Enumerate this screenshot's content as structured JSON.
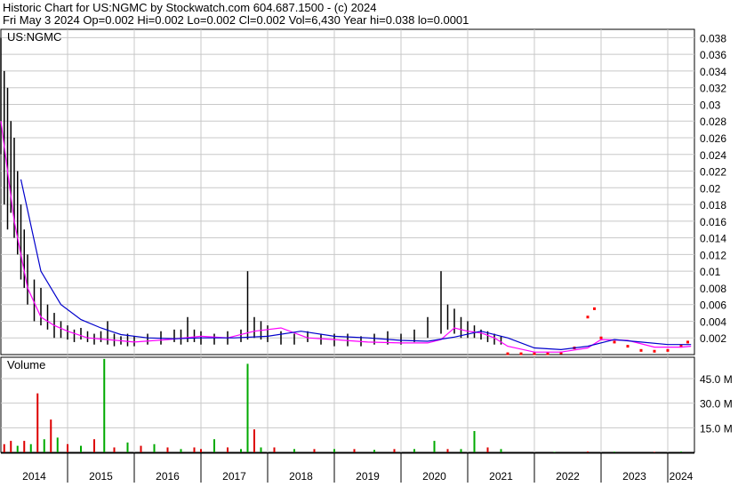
{
  "header": {
    "title_line": "Historic Chart for US:NGMC by Stockwatch.com 604.687.1500 - (c) 2024",
    "quote_line": "Fri May  3 2024  Op=0.002  Hi=0.002  Lo=0.002  Cl=0.002  Vol=6,430  Year hi=0.038  lo=0.0001"
  },
  "colors": {
    "background": "#ffffff",
    "grid": "#c8c8c8",
    "price_bar": "#000000",
    "price_low_marker": "#ff0000",
    "ma_short": "#ff00ff",
    "ma_long": "#0000cc",
    "volume_up": "#00aa00",
    "volume_down": "#dd0000"
  },
  "chart_data": [
    {
      "type": "line",
      "panel": "price",
      "title": "US:NGMC",
      "yticks": [
        "0.038",
        "0.036",
        "0.034",
        "0.032",
        "0.03",
        "0.028",
        "0.026",
        "0.024",
        "0.022",
        "0.02",
        "0.018",
        "0.016",
        "0.014",
        "0.012",
        "0.01",
        "0.008",
        "0.006",
        "0.004",
        "0.002"
      ],
      "ylim": [
        0.0,
        0.039
      ],
      "xlim": [
        2014.0,
        2024.4
      ],
      "grid": true,
      "series": [
        {
          "style": "bars",
          "x": [
            2014.0,
            2014.05,
            2014.1,
            2014.15,
            2014.2,
            2014.25,
            2014.3,
            2014.35,
            2014.4,
            2014.5,
            2014.6,
            2014.7,
            2014.8,
            2014.9,
            2015.0,
            2015.1,
            2015.2,
            2015.3,
            2015.4,
            2015.5,
            2015.6,
            2015.7,
            2015.8,
            2015.9,
            2016.0,
            2016.2,
            2016.4,
            2016.6,
            2016.7,
            2016.8,
            2016.9,
            2017.0,
            2017.2,
            2017.4,
            2017.6,
            2017.7,
            2017.8,
            2017.9,
            2018.0,
            2018.2,
            2018.4,
            2018.6,
            2018.8,
            2019.0,
            2019.2,
            2019.4,
            2019.6,
            2019.8,
            2020.0,
            2020.2,
            2020.4,
            2020.6,
            2020.7,
            2020.8,
            2020.9,
            2021.0,
            2021.1,
            2021.2,
            2021.3,
            2021.4,
            2021.5
          ],
          "low": [
            0.024,
            0.018,
            0.015,
            0.017,
            0.014,
            0.012,
            0.009,
            0.008,
            0.006,
            0.004,
            0.0035,
            0.003,
            0.002,
            0.002,
            0.0018,
            0.0015,
            0.0018,
            0.0015,
            0.0012,
            0.0015,
            0.0012,
            0.001,
            0.0012,
            0.001,
            0.001,
            0.0012,
            0.0012,
            0.0015,
            0.0012,
            0.0015,
            0.0015,
            0.0012,
            0.0012,
            0.0012,
            0.0015,
            0.0018,
            0.002,
            0.0018,
            0.0015,
            0.0012,
            0.0012,
            0.0015,
            0.0012,
            0.001,
            0.001,
            0.001,
            0.0012,
            0.0012,
            0.0012,
            0.0015,
            0.002,
            0.0025,
            0.003,
            0.0025,
            0.002,
            0.002,
            0.002,
            0.0018,
            0.0015,
            0.0012,
            0.0012
          ],
          "high": [
            0.038,
            0.034,
            0.032,
            0.028,
            0.026,
            0.022,
            0.018,
            0.015,
            0.012,
            0.009,
            0.008,
            0.006,
            0.005,
            0.004,
            0.0035,
            0.003,
            0.0032,
            0.0028,
            0.0025,
            0.0028,
            0.004,
            0.0025,
            0.0022,
            0.0025,
            0.0022,
            0.0025,
            0.0028,
            0.003,
            0.003,
            0.0045,
            0.003,
            0.0028,
            0.0025,
            0.0028,
            0.003,
            0.01,
            0.0045,
            0.004,
            0.0035,
            0.0028,
            0.0025,
            0.0028,
            0.0025,
            0.0025,
            0.0025,
            0.0022,
            0.0025,
            0.0028,
            0.0025,
            0.003,
            0.0045,
            0.01,
            0.006,
            0.0055,
            0.0045,
            0.004,
            0.0035,
            0.003,
            0.0028,
            0.0025,
            0.0022
          ]
        },
        {
          "name": "",
          "style": "lows",
          "x": [
            2021.6,
            2021.8,
            2022.0,
            2022.2,
            2022.4,
            2022.6,
            2022.8,
            2022.9,
            2023.0,
            2023.2,
            2023.4,
            2023.6,
            2023.8,
            2024.0,
            2024.2,
            2024.3
          ],
          "y": [
            0.0001,
            0.0001,
            0.0001,
            0.0001,
            0.0002,
            0.0008,
            0.0045,
            0.0055,
            0.002,
            0.0015,
            0.001,
            0.0005,
            0.0004,
            0.0005,
            0.001,
            0.0015
          ]
        },
        {
          "name": "",
          "style": "ma_short",
          "x": [
            2014.0,
            2014.2,
            2014.4,
            2014.6,
            2014.8,
            2015.0,
            2015.3,
            2015.6,
            2016.0,
            2016.5,
            2017.0,
            2017.4,
            2017.8,
            2018.2,
            2018.6,
            2019.0,
            2019.5,
            2020.0,
            2020.4,
            2020.6,
            2020.8,
            2021.0,
            2021.2,
            2021.4,
            2021.6,
            2022.0,
            2022.4,
            2022.8,
            2023.0,
            2023.4,
            2023.8,
            2024.2,
            2024.35
          ],
          "y": [
            0.028,
            0.016,
            0.008,
            0.0045,
            0.0035,
            0.0028,
            0.002,
            0.0018,
            0.0015,
            0.0018,
            0.0022,
            0.002,
            0.0028,
            0.0032,
            0.002,
            0.0018,
            0.0015,
            0.0014,
            0.0014,
            0.0018,
            0.0032,
            0.0028,
            0.0026,
            0.002,
            0.001,
            0.0003,
            0.0003,
            0.0008,
            0.0018,
            0.0017,
            0.0009,
            0.0009,
            0.001
          ]
        },
        {
          "name": "",
          "style": "ma_long",
          "x": [
            2014.3,
            2014.6,
            2014.9,
            2015.2,
            2015.5,
            2015.8,
            2016.2,
            2016.6,
            2017.0,
            2017.5,
            2018.0,
            2018.5,
            2019.0,
            2019.5,
            2020.0,
            2020.4,
            2020.8,
            2021.2,
            2021.6,
            2022.0,
            2022.4,
            2022.8,
            2023.2,
            2023.6,
            2024.0,
            2024.35
          ],
          "y": [
            0.021,
            0.01,
            0.006,
            0.0042,
            0.0032,
            0.0024,
            0.002,
            0.0019,
            0.002,
            0.002,
            0.0022,
            0.0028,
            0.0022,
            0.002,
            0.0017,
            0.0016,
            0.0021,
            0.0028,
            0.002,
            0.0008,
            0.0006,
            0.001,
            0.0018,
            0.0015,
            0.0012,
            0.0012
          ]
        }
      ]
    },
    {
      "type": "bar",
      "panel": "volume",
      "title": "Volume",
      "yticks": [
        "45.0 M",
        "30.0 M",
        "15.0 M"
      ],
      "ylim": [
        0,
        58
      ],
      "xlim": [
        2014.0,
        2024.4
      ],
      "x": [
        2014.05,
        2014.15,
        2014.25,
        2014.35,
        2014.45,
        2014.55,
        2014.65,
        2014.75,
        2014.85,
        2015.0,
        2015.2,
        2015.4,
        2015.55,
        2015.7,
        2015.9,
        2016.1,
        2016.3,
        2016.5,
        2016.7,
        2016.9,
        2017.0,
        2017.2,
        2017.4,
        2017.6,
        2017.7,
        2017.8,
        2017.9,
        2018.1,
        2018.4,
        2018.7,
        2019.0,
        2019.3,
        2019.6,
        2019.9,
        2020.2,
        2020.5,
        2020.7,
        2020.9,
        2021.1,
        2021.3,
        2021.5,
        2022.3,
        2022.8,
        2023.2,
        2023.8,
        2024.2
      ],
      "values": [
        5,
        7,
        4,
        7,
        5,
        36,
        8,
        20,
        9,
        5,
        4,
        8,
        57,
        3,
        6,
        4,
        5,
        3,
        2,
        3,
        2,
        8,
        3,
        2,
        54,
        14,
        3,
        3,
        2,
        2,
        2,
        2,
        1.5,
        2,
        2,
        7,
        2,
        2,
        13,
        3,
        2,
        0.3,
        0.5,
        0.4,
        0.3,
        0.5
      ],
      "colors": [
        "down",
        "down",
        "up",
        "down",
        "up",
        "down",
        "up",
        "down",
        "up",
        "down",
        "up",
        "down",
        "up",
        "down",
        "up",
        "down",
        "up",
        "down",
        "up",
        "down",
        "down",
        "up",
        "down",
        "up",
        "up",
        "down",
        "up",
        "down",
        "up",
        "down",
        "up",
        "down",
        "up",
        "down",
        "up",
        "up",
        "down",
        "up",
        "up",
        "down",
        "up",
        "up",
        "down",
        "up",
        "down",
        "up"
      ]
    }
  ],
  "x_axis": {
    "year_labels": [
      "2014",
      "2015",
      "2016",
      "2017",
      "2018",
      "2019",
      "2020",
      "2021",
      "2022",
      "2023",
      "2024"
    ],
    "year_positions": [
      2014,
      2015,
      2016,
      2017,
      2018,
      2019,
      2020,
      2021,
      2022,
      2023,
      2024
    ]
  }
}
